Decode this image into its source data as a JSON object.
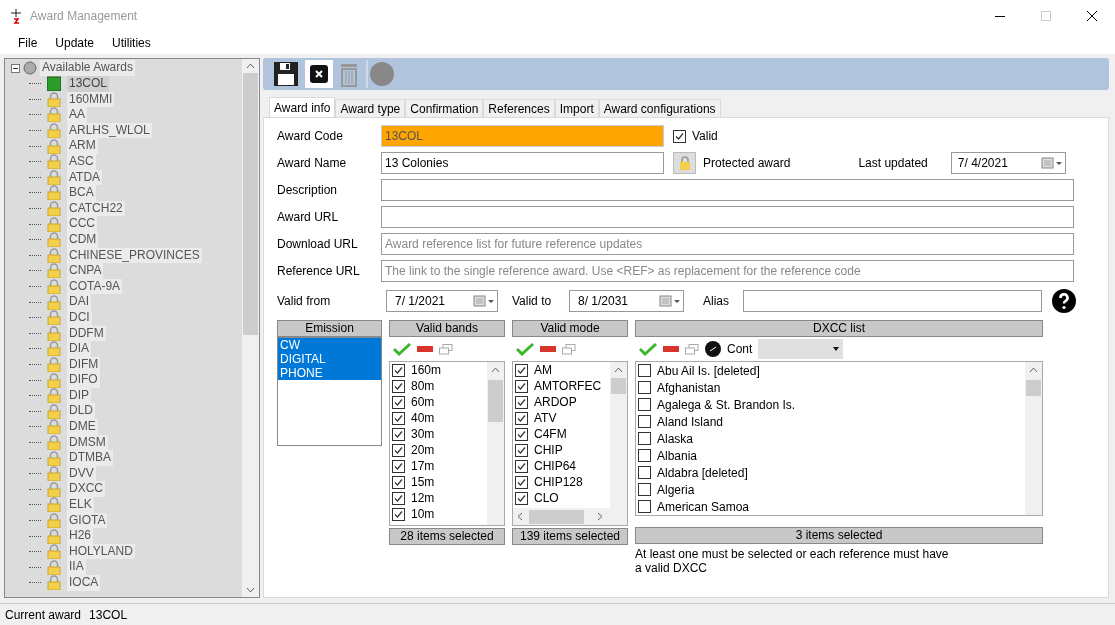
{
  "window": {
    "title": "Award Management"
  },
  "menu": [
    "File",
    "Update",
    "Utilities"
  ],
  "tree": {
    "root": "Available Awards",
    "expanded": true,
    "items": [
      {
        "label": "13COL",
        "selected": true
      },
      {
        "label": "160MMI",
        "selected": false
      },
      {
        "label": "AA",
        "selected": false
      },
      {
        "label": "ARLHS_WLOL",
        "selected": false
      },
      {
        "label": "ARM",
        "selected": false
      },
      {
        "label": "ASC",
        "selected": false
      },
      {
        "label": "ATDA",
        "selected": false
      },
      {
        "label": "BCA",
        "selected": false
      },
      {
        "label": "CATCH22",
        "selected": false
      },
      {
        "label": "CCC",
        "selected": false
      },
      {
        "label": "CDM",
        "selected": false
      },
      {
        "label": "CHINESE_PROVINCES",
        "selected": false
      },
      {
        "label": "CNPA",
        "selected": false
      },
      {
        "label": "COTA-9A",
        "selected": false
      },
      {
        "label": "DAI",
        "selected": false
      },
      {
        "label": "DCI",
        "selected": false
      },
      {
        "label": "DDFM",
        "selected": false
      },
      {
        "label": "DIA",
        "selected": false
      },
      {
        "label": "DIFM",
        "selected": false
      },
      {
        "label": "DIFO",
        "selected": false
      },
      {
        "label": "DIP",
        "selected": false
      },
      {
        "label": "DLD",
        "selected": false
      },
      {
        "label": "DME",
        "selected": false
      },
      {
        "label": "DMSM",
        "selected": false
      },
      {
        "label": "DTMBA",
        "selected": false
      },
      {
        "label": "DVV",
        "selected": false
      },
      {
        "label": "DXCC",
        "selected": false
      },
      {
        "label": "ELK",
        "selected": false
      },
      {
        "label": "GIOTA",
        "selected": false
      },
      {
        "label": "H26",
        "selected": false
      },
      {
        "label": "HOLYLAND",
        "selected": false
      },
      {
        "label": "IIA",
        "selected": false
      },
      {
        "label": "IOCA",
        "selected": false
      }
    ]
  },
  "tabs": [
    {
      "label": "Award info",
      "selected": true
    },
    {
      "label": "Award type",
      "selected": false
    },
    {
      "label": "Confirmation",
      "selected": false
    },
    {
      "label": "References",
      "selected": false
    },
    {
      "label": "Import",
      "selected": false
    },
    {
      "label": "Award configurations",
      "selected": false
    }
  ],
  "form": {
    "award_code": {
      "label": "Award Code",
      "value": "13COL"
    },
    "valid": {
      "label": "Valid",
      "checked": true
    },
    "award_name": {
      "label": "Award Name",
      "value": "13 Colonies"
    },
    "protected": {
      "label": "Protected award"
    },
    "last_updated": {
      "label": "Last updated",
      "value": "7/ 4/2021"
    },
    "description": {
      "label": "Description"
    },
    "award_url": {
      "label": "Award URL"
    },
    "download_url": {
      "label": "Download URL",
      "placeholder": "Award reference list for future reference updates"
    },
    "reference_url": {
      "label": "Reference URL",
      "placeholder": "The link to the single reference award. Use <REF> as replacement for the reference code"
    },
    "valid_from": {
      "label": "Valid from",
      "value": "7/ 1/2021"
    },
    "valid_to": {
      "label": "Valid to",
      "value": "8/ 1/2031"
    },
    "alias": {
      "label": "Alias"
    }
  },
  "emission": {
    "title": "Emission",
    "items": [
      {
        "label": "CW",
        "selected": true
      },
      {
        "label": "DIGITAL",
        "selected": true
      },
      {
        "label": "PHONE",
        "selected": true
      }
    ]
  },
  "bands": {
    "title": "Valid bands",
    "footer": "28 items selected",
    "items": [
      {
        "label": "160m",
        "checked": true
      },
      {
        "label": "80m",
        "checked": true
      },
      {
        "label": "60m",
        "checked": true
      },
      {
        "label": "40m",
        "checked": true
      },
      {
        "label": "30m",
        "checked": true
      },
      {
        "label": "20m",
        "checked": true
      },
      {
        "label": "17m",
        "checked": true
      },
      {
        "label": "15m",
        "checked": true
      },
      {
        "label": "12m",
        "checked": true
      },
      {
        "label": "10m",
        "checked": true
      }
    ]
  },
  "modes": {
    "title": "Valid mode",
    "footer": "139 items selected",
    "items": [
      {
        "label": "AM",
        "checked": true
      },
      {
        "label": "AMTORFEC",
        "checked": true
      },
      {
        "label": "ARDOP",
        "checked": true
      },
      {
        "label": "ATV",
        "checked": true
      },
      {
        "label": "C4FM",
        "checked": true
      },
      {
        "label": "CHIP",
        "checked": true
      },
      {
        "label": "CHIP64",
        "checked": true
      },
      {
        "label": "CHIP128",
        "checked": true
      },
      {
        "label": "CLO",
        "checked": true
      }
    ]
  },
  "dxcc": {
    "title": "DXCC list",
    "cont_label": "Cont",
    "footer": "3 items selected",
    "note": "At least one must be selected or each reference must have a valid DXCC",
    "items": [
      {
        "label": "Abu Ail Is. [deleted]",
        "checked": false
      },
      {
        "label": "Afghanistan",
        "checked": false
      },
      {
        "label": "Agalega & St. Brandon Is.",
        "checked": false
      },
      {
        "label": "Aland Island",
        "checked": false
      },
      {
        "label": "Alaska",
        "checked": false
      },
      {
        "label": "Albania",
        "checked": false
      },
      {
        "label": "Aldabra [deleted]",
        "checked": false
      },
      {
        "label": "Algeria",
        "checked": false
      },
      {
        "label": "American Samoa",
        "checked": false
      }
    ]
  },
  "status_bar": {
    "label": "Current award",
    "value": "13COL"
  }
}
